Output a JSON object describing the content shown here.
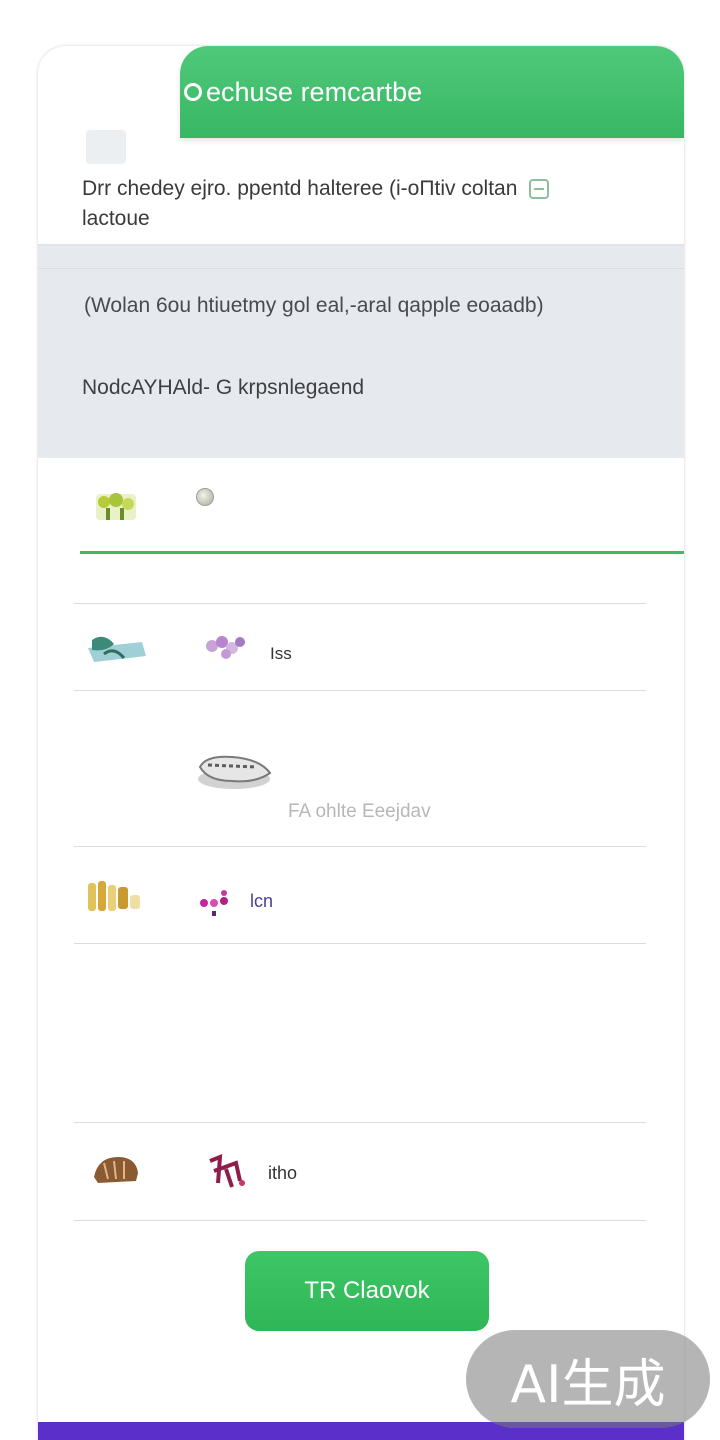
{
  "header": {
    "title": "echuse remcartbe"
  },
  "intro": {
    "text": "Drr chedey ejro. ppentd halteree (i-oΠtiv coltan",
    "text2": "lactoue"
  },
  "panel": {
    "line1": "(Wolan 6ou htiuetmy gol eal,-aral qapple eoaadb)",
    "line2": "NodcAYHAld- G krpsnlegaend"
  },
  "items": [
    {
      "label": "Iss"
    },
    {
      "label": "FA ohlte Eeejdav"
    },
    {
      "label": "lcn"
    },
    {
      "label": "itho"
    }
  ],
  "cta": {
    "label": "TR Claovok"
  },
  "watermark": "AI生成",
  "colors": {
    "accent": "#39b764",
    "panel": "#e6e9ee",
    "bottom_bar": "#5b2fc9"
  }
}
